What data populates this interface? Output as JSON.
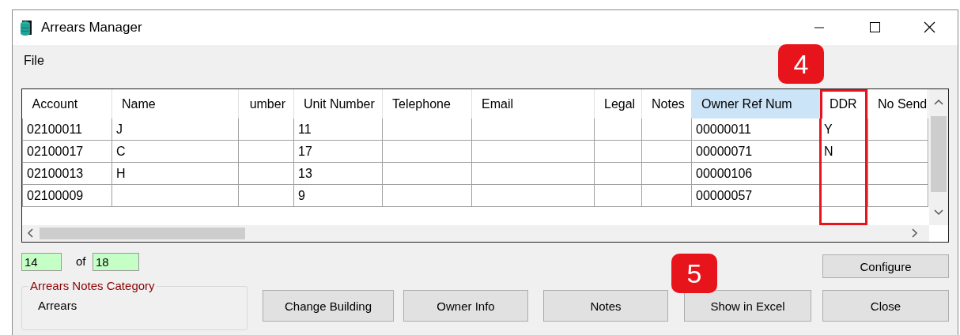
{
  "window": {
    "title": "Arrears Manager"
  },
  "menu": [
    "File"
  ],
  "table": {
    "columns": [
      {
        "label": "Account",
        "selected": false,
        "highlighted": false
      },
      {
        "label": "Name",
        "selected": false,
        "highlighted": false
      },
      {
        "label": "umber",
        "selected": false,
        "highlighted": false
      },
      {
        "label": "Unit Number",
        "selected": false,
        "highlighted": false
      },
      {
        "label": "Telephone",
        "selected": false,
        "highlighted": false
      },
      {
        "label": "Email",
        "selected": false,
        "highlighted": false
      },
      {
        "label": "Legal",
        "selected": false,
        "highlighted": false
      },
      {
        "label": "Notes",
        "selected": false,
        "highlighted": false
      },
      {
        "label": "Owner Ref Num",
        "selected": true,
        "highlighted": false
      },
      {
        "label": "DDR",
        "selected": false,
        "highlighted": true
      },
      {
        "label": "No Send",
        "selected": false,
        "highlighted": false
      }
    ],
    "rows": [
      [
        "02100011",
        "J",
        "",
        "11",
        "",
        "",
        "",
        "",
        "00000011",
        "Y",
        ""
      ],
      [
        "02100017",
        "C",
        "",
        "17",
        "",
        "",
        "",
        "",
        "00000071",
        "N",
        ""
      ],
      [
        "02100013",
        "H",
        "",
        "13",
        "",
        "",
        "",
        "",
        "00000106",
        "",
        ""
      ],
      [
        "02100009",
        "",
        "",
        "9",
        "",
        "",
        "",
        "",
        "00000057",
        "",
        ""
      ]
    ]
  },
  "counter": {
    "current": "14",
    "separator": "of",
    "total": "18"
  },
  "notes_category": {
    "legend": "Arrears Notes Category",
    "value": "Arrears"
  },
  "buttons": [
    {
      "label": "Configure"
    },
    {
      "label": "Change Building"
    },
    {
      "label": "Owner Info"
    },
    {
      "label": "Notes"
    },
    {
      "label": "Show in Excel"
    },
    {
      "label": "Close"
    }
  ],
  "callouts": [
    {
      "number": "4"
    },
    {
      "number": "5"
    }
  ]
}
